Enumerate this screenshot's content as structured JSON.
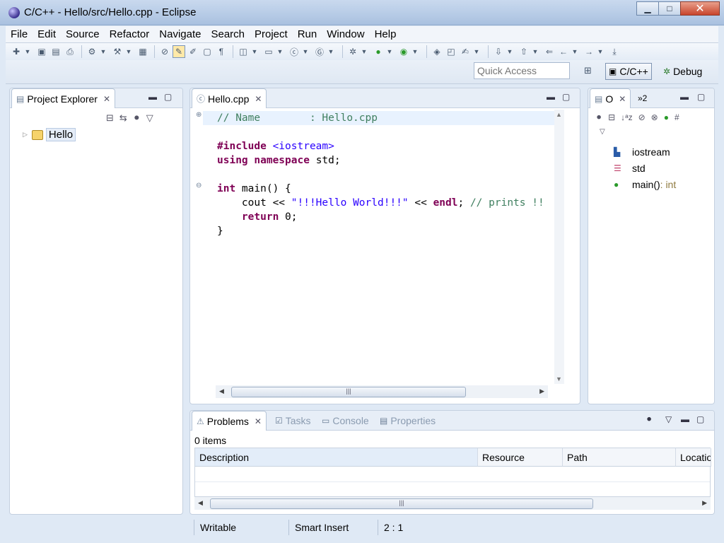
{
  "window": {
    "title": "C/C++ - Hello/src/Hello.cpp - Eclipse",
    "minimize": "▁",
    "maximize": "□",
    "close": "✕"
  },
  "menu": [
    "File",
    "Edit",
    "Source",
    "Refactor",
    "Navigate",
    "Search",
    "Project",
    "Run",
    "Window",
    "Help"
  ],
  "quick_access": {
    "placeholder": "Quick Access"
  },
  "perspectives": {
    "cpp": "C/C++",
    "debug": "Debug"
  },
  "project_explorer": {
    "tab": "Project Explorer",
    "tree": [
      {
        "label": "Hello"
      }
    ]
  },
  "editor": {
    "tab": "Hello.cpp",
    "lines": {
      "l1_cmt": "// Name        : Hello.cpp",
      "l3_kw": "#include",
      "l3_inc": " <iostream>",
      "l4_kw1": "using",
      "l4_kw2": "namespace",
      "l4_rest": " std;",
      "l6_kw": "int",
      "l6_rest": " main() {",
      "l7_a": "    cout << ",
      "l7_str": "\"!!!Hello World!!!\"",
      "l7_b": " << ",
      "l7_endl": "endl",
      "l7_c": "; ",
      "l7_cmt": "// prints !!",
      "l8_kw": "    return",
      "l8_rest": " 0;",
      "l9": "}"
    }
  },
  "outline": {
    "tab": "O",
    "overflow": "»2",
    "items": [
      {
        "label": "iostream",
        "icon": "include-icon"
      },
      {
        "label": "std",
        "icon": "namespace-icon"
      },
      {
        "label": "main()",
        "type": " : int",
        "icon": "function-icon"
      }
    ]
  },
  "bottom": {
    "tabs": [
      "Problems",
      "Tasks",
      "Console",
      "Properties"
    ],
    "count": "0 items",
    "columns": [
      "Description",
      "Resource",
      "Path",
      "Locatio"
    ]
  },
  "status": {
    "writable": "Writable",
    "insert_mode": "Smart Insert",
    "position": "2 : 1"
  },
  "colors": {
    "keyword": "#7f0055",
    "string": "#2a00ff",
    "comment": "#3f7f5f",
    "current_line": "#e8f2fe"
  }
}
